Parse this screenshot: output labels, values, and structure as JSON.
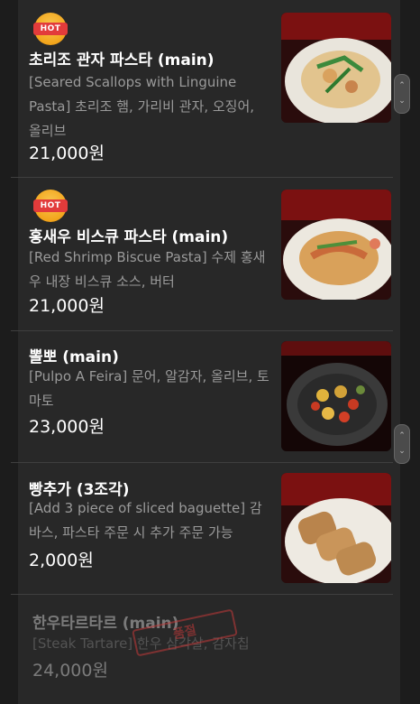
{
  "menu_items": [
    {
      "badge": "HOT",
      "name": "초리조 관자 파스타 (main)",
      "desc": "[Seared Scallops with Linguine Pasta] 초리조 햄, 가리비 관자, 오징어, 올리브",
      "price": "21,000원",
      "photo": "scallop-pasta-photo"
    },
    {
      "badge": "HOT",
      "name": "홍새우 비스큐 파스타 (main)",
      "desc": "[Red Shrimp Biscue Pasta] 수제 홍새우 내장 비스큐 소스, 버터",
      "price": "21,000원",
      "photo": "shrimp-pasta-photo"
    },
    {
      "name": "뽈뽀 (main)",
      "desc": "[Pulpo A Feira] 문어, 알감자, 올리브, 토마토",
      "price": "23,000원",
      "photo": "octopus-dish-photo"
    },
    {
      "name": "빵추가 (3조각)",
      "desc": "[Add 3 piece of sliced baguette] 감바스, 파스타 주문 시 추가 주문 가능",
      "price": "2,000원",
      "photo": "baguette-photo"
    },
    {
      "name": "한우타르타르 (main)",
      "desc": "[Steak Tartare] 한우 삼각살, 감자칩",
      "price": "24,000원",
      "stamp": "품절"
    }
  ],
  "colors": {
    "background": "#1c1c1c",
    "panel": "#282828",
    "hot_badge": "#f2a51c",
    "hot_ribbon": "#e23b3b"
  }
}
